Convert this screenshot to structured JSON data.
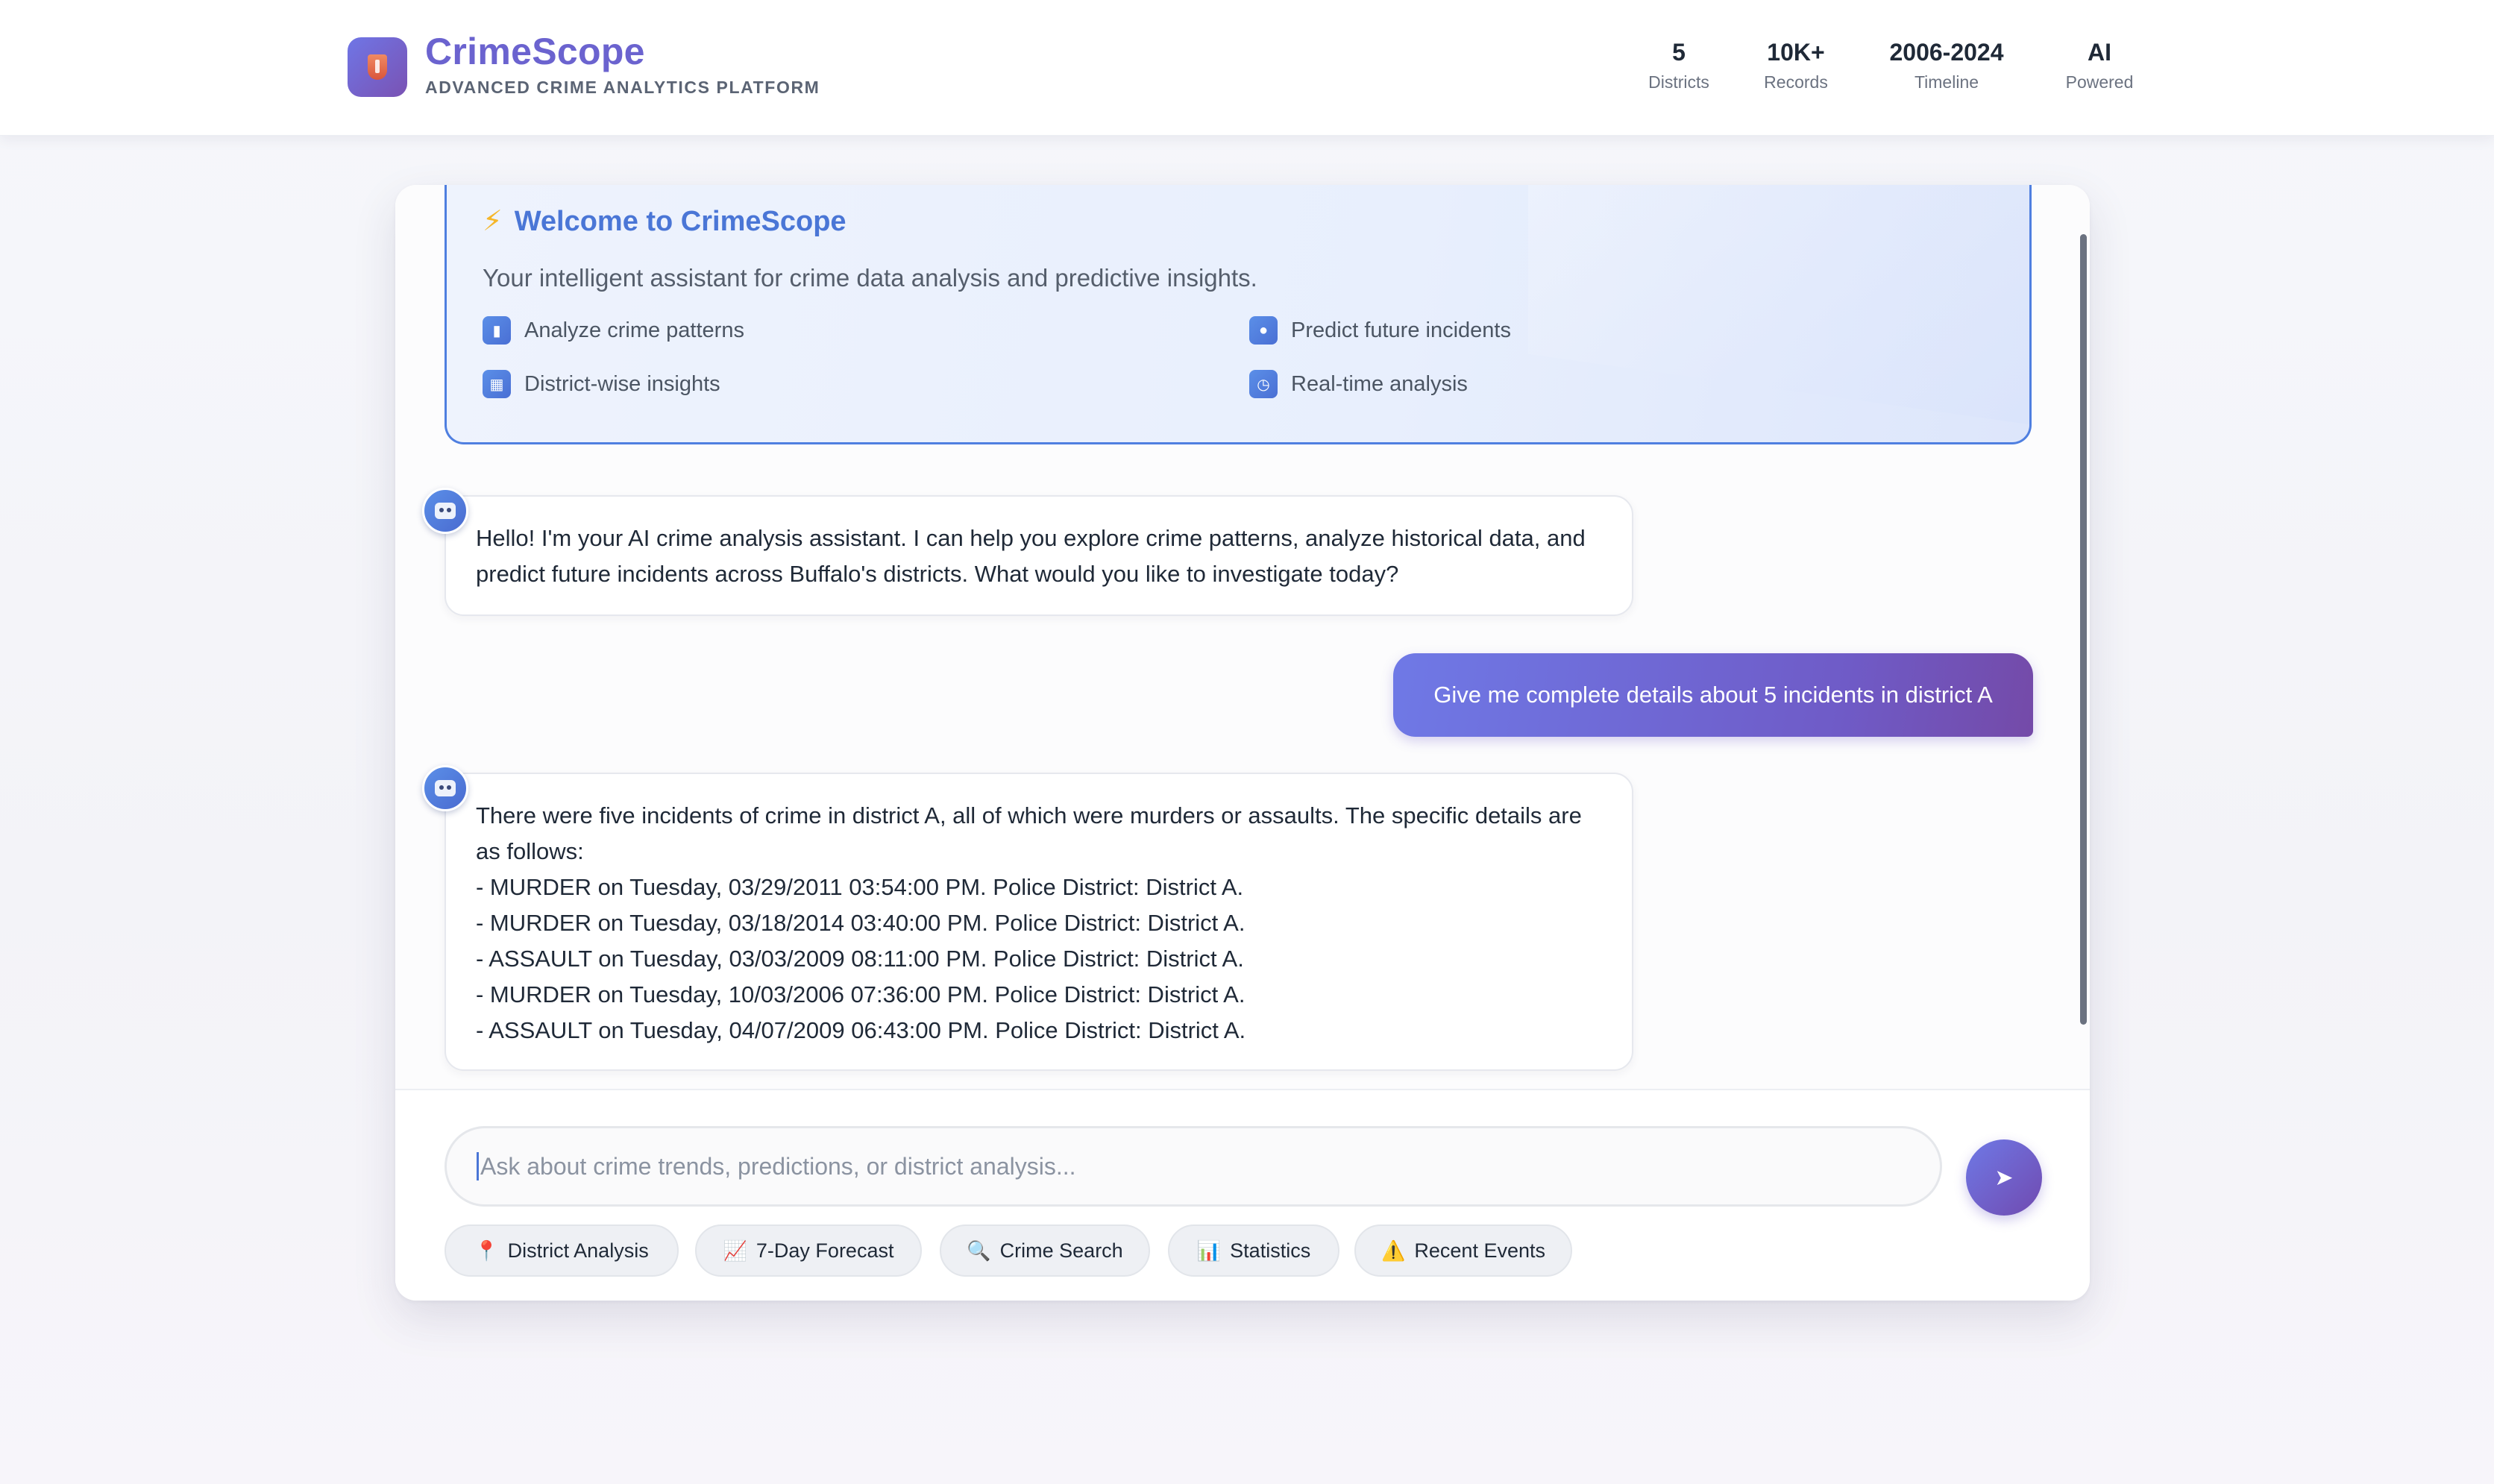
{
  "header": {
    "brand_title": "CrimeScope",
    "brand_subtitle": "ADVANCED CRIME ANALYTICS PLATFORM",
    "stats": [
      {
        "value": "5",
        "label": "Districts"
      },
      {
        "value": "10K+",
        "label": "Records"
      },
      {
        "value": "2006-2024",
        "label": "Timeline"
      },
      {
        "value": "AI",
        "label": "Powered"
      }
    ]
  },
  "welcome": {
    "title": "Welcome to CrimeScope",
    "description": "Your intelligent assistant for crime data analysis and predictive insights.",
    "features": [
      {
        "label": "Analyze crime patterns",
        "icon": "bar-chart-icon"
      },
      {
        "label": "Predict future incidents",
        "icon": "crystal-ball-icon"
      },
      {
        "label": "District-wise insights",
        "icon": "map-icon"
      },
      {
        "label": "Real-time analysis",
        "icon": "clock-icon"
      }
    ]
  },
  "messages": {
    "bot_greeting": "Hello! I'm your AI crime analysis assistant. I can help you explore crime patterns, analyze historical data, and predict future incidents across Buffalo's districts. What would you like to investigate today?",
    "user_query": "Give me complete details about 5 incidents in district A",
    "bot_answer": {
      "intro": "There were five incidents of crime in district A, all of which were murders or assaults. The specific details are as follows:",
      "items": [
        "- MURDER on Tuesday, 03/29/2011 03:54:00 PM. Police District: District A.",
        "- MURDER on Tuesday, 03/18/2014 03:40:00 PM. Police District: District A.",
        "- ASSAULT on Tuesday, 03/03/2009 08:11:00 PM. Police District: District A.",
        "- MURDER on Tuesday, 10/03/2006 07:36:00 PM. Police District: District A.",
        "- ASSAULT on Tuesday, 04/07/2009 06:43:00 PM. Police District: District A."
      ]
    }
  },
  "composer": {
    "placeholder": "Ask about crime trends, predictions, or district analysis...",
    "send_icon": "send-arrow-icon",
    "quick_actions": [
      {
        "icon": "📍",
        "label": "District Analysis"
      },
      {
        "icon": "📈",
        "label": "7-Day Forecast"
      },
      {
        "icon": "🔍",
        "label": "Crime Search"
      },
      {
        "icon": "📊",
        "label": "Statistics"
      },
      {
        "icon": "⚠️",
        "label": "Recent Events"
      }
    ]
  },
  "colors": {
    "brand": "#6b63cf",
    "accent_blue": "#4a76d6",
    "user_bubble_start": "#6f79e6",
    "user_bubble_end": "#744aa8"
  }
}
